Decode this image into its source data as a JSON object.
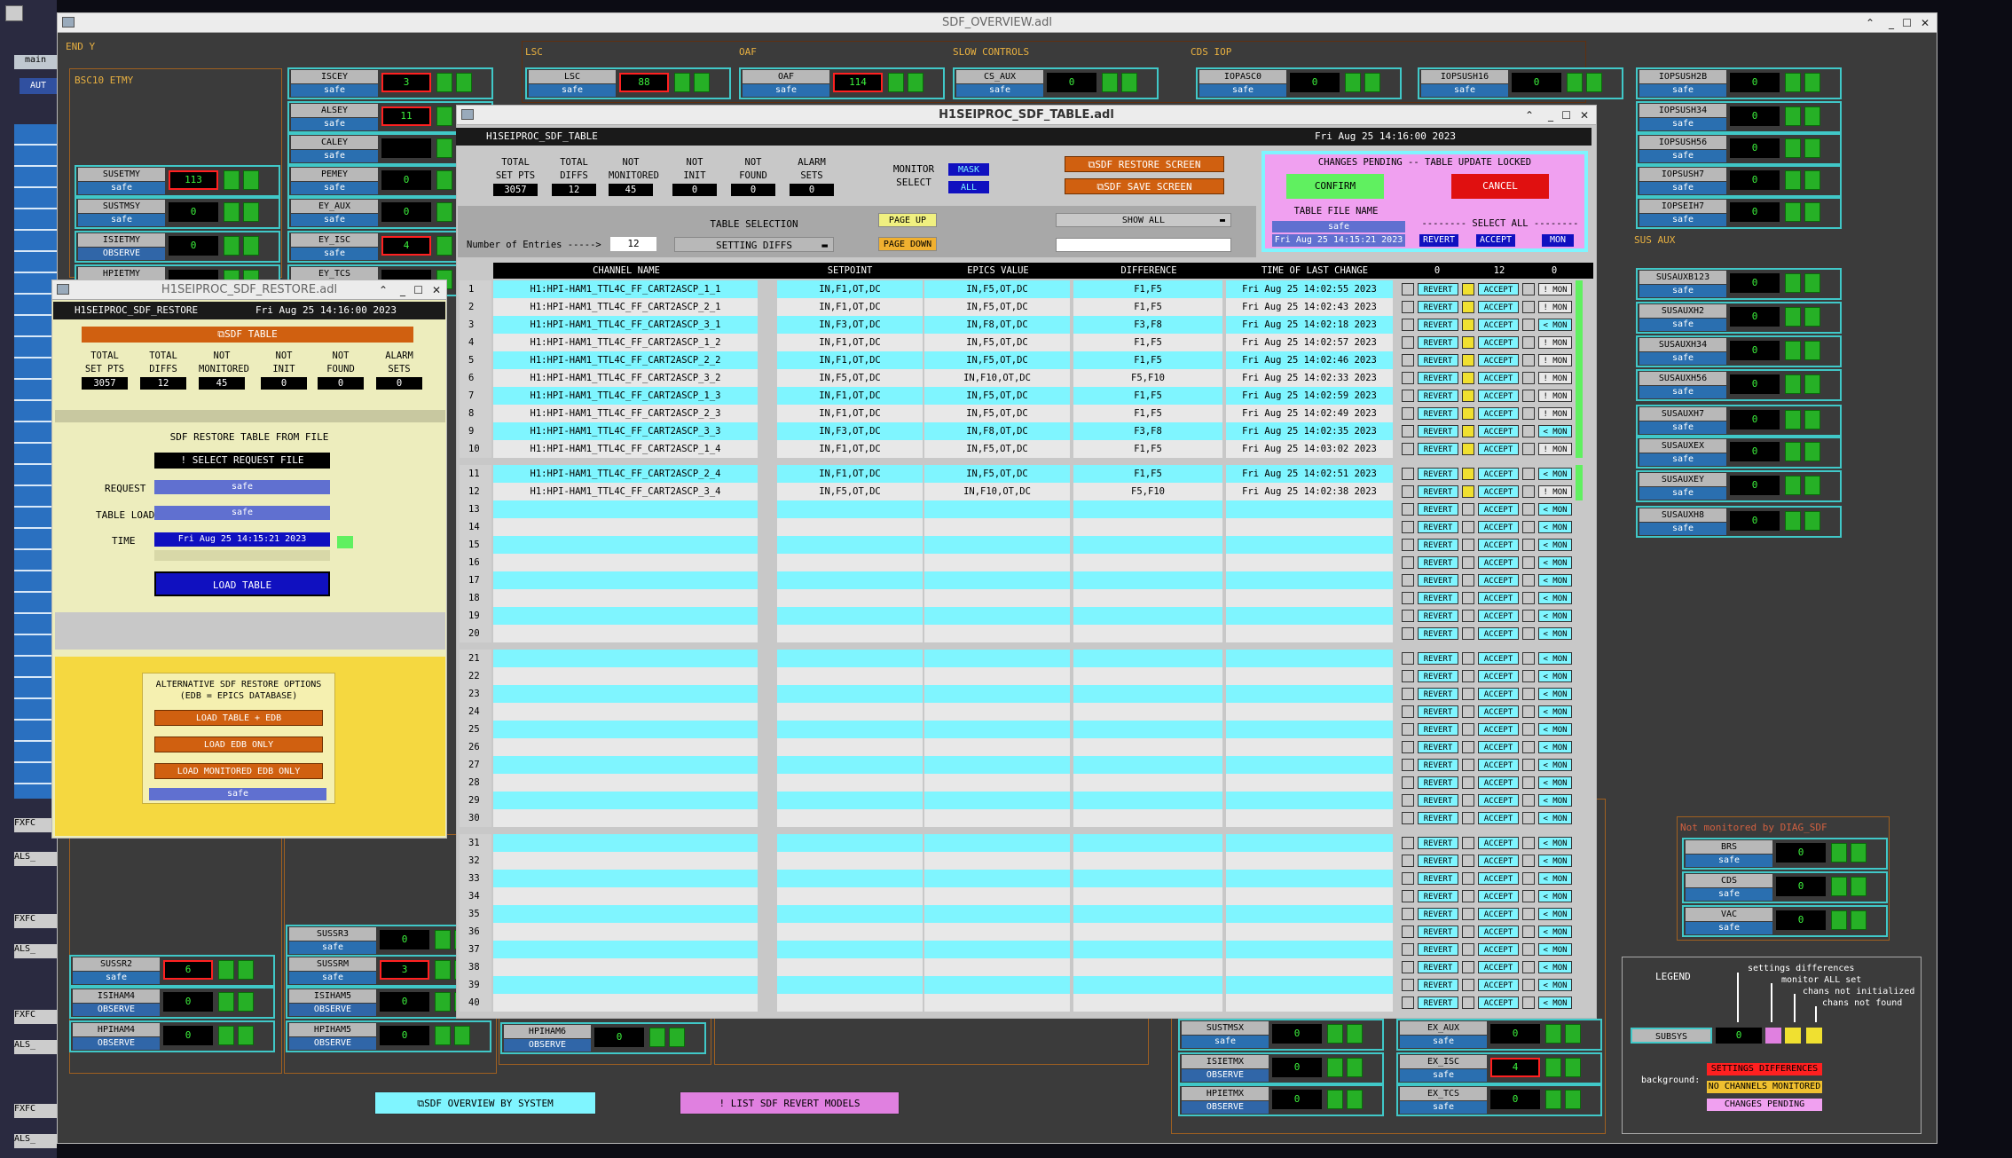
{
  "overview": {
    "title": "SDF_OVERVIEW.adl",
    "groups": {
      "endy": "END Y",
      "bsc10": "BSC10 ETMY",
      "lsc": "LSC",
      "oaf": "OAF",
      "slow": "SLOW CONTROLS",
      "cdsiop": "CDS IOP",
      "susaux": "SUS AUX"
    },
    "records": [
      {
        "name": "SUSETMY",
        "status": "safe",
        "value": "113",
        "alarm": true
      },
      {
        "name": "SUSTMSY",
        "status": "safe",
        "value": "0",
        "alarm": false
      },
      {
        "name": "ISIETMY",
        "status": "OBSERVE",
        "value": "0",
        "alarm": false
      },
      {
        "name": "HPIETMY",
        "status": "",
        "value": "",
        "alarm": false
      },
      {
        "name": "ISCEY",
        "status": "safe",
        "value": "3",
        "alarm": true
      },
      {
        "name": "ALSEY",
        "status": "safe",
        "value": "11",
        "alarm": true
      },
      {
        "name": "CALEY",
        "status": "safe",
        "value": "",
        "alarm": false
      },
      {
        "name": "PEMEY",
        "status": "safe",
        "value": "0",
        "alarm": false
      },
      {
        "name": "EY_AUX",
        "status": "safe",
        "value": "0",
        "alarm": false
      },
      {
        "name": "EY_ISC",
        "status": "safe",
        "value": "4",
        "alarm": true
      },
      {
        "name": "EY_TCS",
        "status": "",
        "value": "",
        "alarm": false
      },
      {
        "name": "LSC",
        "status": "safe",
        "value": "88",
        "alarm": true
      },
      {
        "name": "OAF",
        "status": "safe",
        "value": "114",
        "alarm": true
      },
      {
        "name": "CS_AUX",
        "status": "safe",
        "value": "0",
        "alarm": false
      },
      {
        "name": "IOPASC0",
        "status": "safe",
        "value": "0",
        "alarm": false
      },
      {
        "name": "IOPSUSH16",
        "status": "safe",
        "value": "0",
        "alarm": false
      },
      {
        "name": "IOPSUSH2B",
        "status": "safe",
        "value": "0",
        "alarm": false
      },
      {
        "name": "IOPSUSH34",
        "status": "safe",
        "value": "0",
        "alarm": false
      },
      {
        "name": "IOPSUSH56",
        "status": "safe",
        "value": "0",
        "alarm": false
      },
      {
        "name": "IOPSUSH7",
        "status": "safe",
        "value": "0",
        "alarm": false
      },
      {
        "name": "IOPSEIH7",
        "status": "safe",
        "value": "0",
        "alarm": false
      },
      {
        "name": "SUSAUXB123",
        "status": "safe",
        "value": "0",
        "alarm": false
      },
      {
        "name": "SUSAUXH2",
        "status": "safe",
        "value": "0",
        "alarm": false
      },
      {
        "name": "SUSAUXH34",
        "status": "safe",
        "value": "0",
        "alarm": false
      },
      {
        "name": "SUSAUXH56",
        "status": "safe",
        "value": "0",
        "alarm": false
      },
      {
        "name": "SUSAUXH7",
        "status": "safe",
        "value": "0",
        "alarm": false
      },
      {
        "name": "SUSAUXEX",
        "status": "safe",
        "value": "0",
        "alarm": false
      },
      {
        "name": "SUSAUXEY",
        "status": "safe",
        "value": "0",
        "alarm": false
      },
      {
        "name": "SUSAUXH8",
        "status": "safe",
        "value": "0",
        "alarm": false
      },
      {
        "name": "SUSSR2",
        "status": "safe",
        "value": "6",
        "alarm": true
      },
      {
        "name": "ISIHAM4",
        "status": "OBSERVE",
        "value": "0",
        "alarm": false
      },
      {
        "name": "HPIHAM4",
        "status": "OBSERVE",
        "value": "0",
        "alarm": false
      },
      {
        "name": "SUSSR3",
        "status": "safe",
        "value": "0",
        "alarm": false
      },
      {
        "name": "SUSSRM",
        "status": "safe",
        "value": "3",
        "alarm": true
      },
      {
        "name": "ISIHAM5",
        "status": "OBSERVE",
        "value": "0",
        "alarm": false
      },
      {
        "name": "HPIHAM5",
        "status": "OBSERVE",
        "value": "0",
        "alarm": false
      },
      {
        "name": "HPIHAM6",
        "status": "OBSERVE",
        "value": "0",
        "alarm": false
      },
      {
        "name": "SUSTMSX",
        "status": "safe",
        "value": "0",
        "alarm": false
      },
      {
        "name": "ISIETMX",
        "status": "OBSERVE",
        "value": "0",
        "alarm": false
      },
      {
        "name": "HPIETMX",
        "status": "OBSERVE",
        "value": "0",
        "alarm": false
      },
      {
        "name": "EX_AUX",
        "status": "safe",
        "value": "0",
        "alarm": false
      },
      {
        "name": "EX_ISC",
        "status": "safe",
        "value": "4",
        "alarm": true
      },
      {
        "name": "EX_TCS",
        "status": "safe",
        "value": "0",
        "alarm": false
      },
      {
        "name": "BRS",
        "status": "safe",
        "value": "0",
        "alarm": false
      },
      {
        "name": "CDS",
        "status": "safe",
        "value": "0",
        "alarm": false
      },
      {
        "name": "VAC",
        "status": "safe",
        "value": "0",
        "alarm": false
      }
    ],
    "not_monitored_label": "Not monitored by DIAG_SDF",
    "overview_by_system": "SDF OVERVIEW BY SYSTEM",
    "list_revert": "! LIST SDF REVERT MODELS",
    "legend": {
      "title": "LEGEND",
      "settings_diff": "settings differences",
      "monitor_all": "monitor ALL set",
      "not_init": "chans not initialized",
      "not_found": "chans not found",
      "subsys": "SUBSYS",
      "subsys_val": "0",
      "background": "background:",
      "bg1": "SETTINGS DIFFERENCES",
      "bg2": "NO CHANNELS MONITORED",
      "bg3": "CHANGES PENDING"
    },
    "left_strip": {
      "main": "main",
      "aut": "AUT",
      "fxfc": "FXFC",
      "als": "ALS_"
    }
  },
  "restore": {
    "title": "H1SEIPROC_SDF_RESTORE.adl",
    "header": "H1SEIPROC_SDF_RESTORE",
    "date": "Fri Aug 25 14:16:00 2023",
    "sdf_table_btn": "SDF TABLE",
    "counts": [
      {
        "k": "TOTAL\nSET PTS",
        "v": "3057"
      },
      {
        "k": "TOTAL\nDIFFS",
        "v": "12"
      },
      {
        "k": "NOT\nMONITORED",
        "v": "45"
      },
      {
        "k": "NOT\nINIT",
        "v": "0"
      },
      {
        "k": "NOT\nFOUND",
        "v": "0"
      },
      {
        "k": "ALARM\nSETS",
        "v": "0"
      }
    ],
    "restore_title": "SDF RESTORE TABLE FROM FILE",
    "select_file": "! SELECT REQUEST FILE",
    "request_lbl": "REQUEST",
    "request_val": "safe",
    "tableload_lbl": "TABLE LOAD",
    "tableload_val": "safe",
    "time_lbl": "TIME",
    "time_val": "Fri Aug 25 14:15:21 2023",
    "load_table": "LOAD TABLE",
    "alt_title": "ALTERNATIVE SDF RESTORE OPTIONS",
    "alt_sub": "(EDB = EPICS DATABASE)",
    "alt1": "LOAD TABLE + EDB",
    "alt2": "LOAD EDB ONLY",
    "alt3": "LOAD MONITORED EDB ONLY",
    "alt_val": "safe"
  },
  "table": {
    "title": "H1SEIPROC_SDF_TABLE.adl",
    "header": "H1SEIPROC_SDF_TABLE",
    "date": "Fri Aug 25 14:16:00 2023",
    "counts": [
      {
        "k": "TOTAL\nSET PTS",
        "v": "3057"
      },
      {
        "k": "TOTAL\nDIFFS",
        "v": "12"
      },
      {
        "k": "NOT\nMONITORED",
        "v": "45"
      },
      {
        "k": "NOT\nINIT",
        "v": "0"
      },
      {
        "k": "NOT\nFOUND",
        "v": "0"
      },
      {
        "k": "ALARM\nSETS",
        "v": "0"
      }
    ],
    "monitor_select": "MONITOR\nSELECT",
    "mask": "MASK",
    "all": "ALL",
    "restore_screen": "SDF RESTORE SCREEN",
    "save_screen": "SDF SAVE SCREEN",
    "pending": "CHANGES PENDING -- TABLE UPDATE LOCKED",
    "confirm": "CONFIRM",
    "cancel": "CANCEL",
    "table_file_name": "TABLE FILE NAME",
    "file_status": "safe",
    "file_time": "Fri Aug 25 14:15:21 2023",
    "select_all": "-------- SELECT ALL --------",
    "sa_revert": "REVERT",
    "sa_accept": "ACCEPT",
    "sa_mon": "MON",
    "table_selection": "TABLE SELECTION",
    "setting_diffs": "SETTING DIFFS",
    "page_up": "PAGE UP",
    "page_down": "PAGE DOWN",
    "show_all": "SHOW ALL",
    "num_entries_lbl": "Number of Entries ----->",
    "num_entries": "12",
    "columns": [
      "CHANNEL NAME",
      "SETPOINT",
      "EPICS VALUE",
      "DIFFERENCE",
      "TIME OF LAST CHANGE"
    ],
    "col_counts": [
      "0",
      "12",
      "0"
    ],
    "rows": [
      {
        "n": "1",
        "ch": "H1:HPI-HAM1_TTL4C_FF_CART2ASCP_1_1",
        "sp": "IN,F1,OT,DC",
        "ev": "IN,F5,OT,DC",
        "df": "F1,F5",
        "t": "Fri Aug 25 14:02:55 2023"
      },
      {
        "n": "2",
        "ch": "H1:HPI-HAM1_TTL4C_FF_CART2ASCP_2_1",
        "sp": "IN,F1,OT,DC",
        "ev": "IN,F5,OT,DC",
        "df": "F1,F5",
        "t": "Fri Aug 25 14:02:43 2023"
      },
      {
        "n": "3",
        "ch": "H1:HPI-HAM1_TTL4C_FF_CART2ASCP_3_1",
        "sp": "IN,F3,OT,DC",
        "ev": "IN,F8,OT,DC",
        "df": "F3,F8",
        "t": "Fri Aug 25 14:02:18 2023"
      },
      {
        "n": "4",
        "ch": "H1:HPI-HAM1_TTL4C_FF_CART2ASCP_1_2",
        "sp": "IN,F1,OT,DC",
        "ev": "IN,F5,OT,DC",
        "df": "F1,F5",
        "t": "Fri Aug 25 14:02:57 2023"
      },
      {
        "n": "5",
        "ch": "H1:HPI-HAM1_TTL4C_FF_CART2ASCP_2_2",
        "sp": "IN,F1,OT,DC",
        "ev": "IN,F5,OT,DC",
        "df": "F1,F5",
        "t": "Fri Aug 25 14:02:46 2023"
      },
      {
        "n": "6",
        "ch": "H1:HPI-HAM1_TTL4C_FF_CART2ASCP_3_2",
        "sp": "IN,F5,OT,DC",
        "ev": "IN,F10,OT,DC",
        "df": "F5,F10",
        "t": "Fri Aug 25 14:02:33 2023"
      },
      {
        "n": "7",
        "ch": "H1:HPI-HAM1_TTL4C_FF_CART2ASCP_1_3",
        "sp": "IN,F1,OT,DC",
        "ev": "IN,F5,OT,DC",
        "df": "F1,F5",
        "t": "Fri Aug 25 14:02:59 2023"
      },
      {
        "n": "8",
        "ch": "H1:HPI-HAM1_TTL4C_FF_CART2ASCP_2_3",
        "sp": "IN,F1,OT,DC",
        "ev": "IN,F5,OT,DC",
        "df": "F1,F5",
        "t": "Fri Aug 25 14:02:49 2023"
      },
      {
        "n": "9",
        "ch": "H1:HPI-HAM1_TTL4C_FF_CART2ASCP_3_3",
        "sp": "IN,F3,OT,DC",
        "ev": "IN,F8,OT,DC",
        "df": "F3,F8",
        "t": "Fri Aug 25 14:02:35 2023"
      },
      {
        "n": "10",
        "ch": "H1:HPI-HAM1_TTL4C_FF_CART2ASCP_1_4",
        "sp": "IN,F1,OT,DC",
        "ev": "IN,F5,OT,DC",
        "df": "F1,F5",
        "t": "Fri Aug 25 14:03:02 2023"
      },
      {
        "n": "11",
        "ch": "H1:HPI-HAM1_TTL4C_FF_CART2ASCP_2_4",
        "sp": "IN,F1,OT,DC",
        "ev": "IN,F5,OT,DC",
        "df": "F1,F5",
        "t": "Fri Aug 25 14:02:51 2023"
      },
      {
        "n": "12",
        "ch": "H1:HPI-HAM1_TTL4C_FF_CART2ASCP_3_4",
        "sp": "IN,F5,OT,DC",
        "ev": "IN,F10,OT,DC",
        "df": "F5,F10",
        "t": "Fri Aug 25 14:02:38 2023"
      }
    ],
    "revert": "REVERT",
    "accept": "ACCEPT",
    "mon_active": "! MON",
    "mon_idle": "< MON"
  }
}
